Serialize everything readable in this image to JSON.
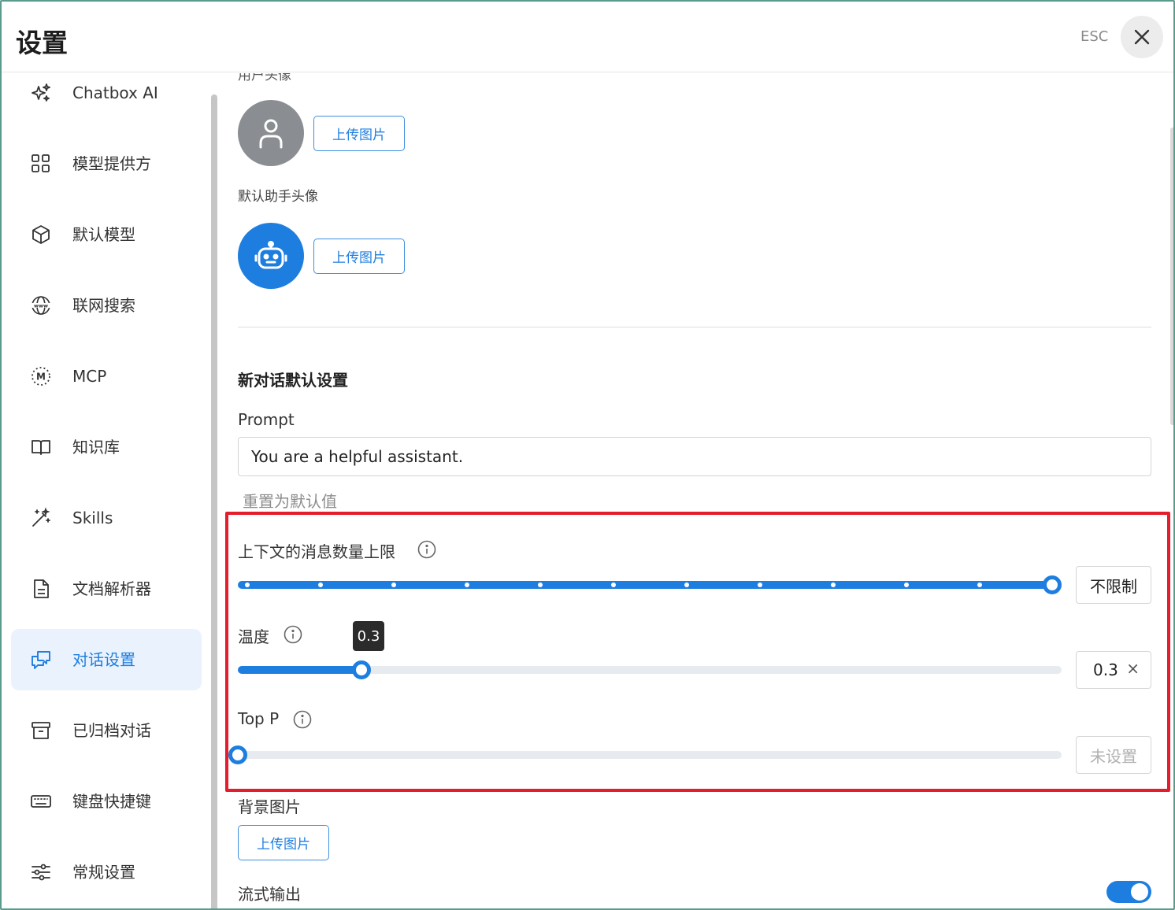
{
  "header": {
    "title": "设置",
    "esc_label": "ESC"
  },
  "sidebar": {
    "items": [
      {
        "label": "Chatbox AI",
        "icon": "sparkle-icon"
      },
      {
        "label": "模型提供方",
        "icon": "grid-icon"
      },
      {
        "label": "默认模型",
        "icon": "cube-icon"
      },
      {
        "label": "联网搜索",
        "icon": "globe-www-icon"
      },
      {
        "label": "MCP",
        "icon": "mcp-icon"
      },
      {
        "label": "知识库",
        "icon": "book-icon"
      },
      {
        "label": "Skills",
        "icon": "magic-wand-icon"
      },
      {
        "label": "文档解析器",
        "icon": "document-icon"
      },
      {
        "label": "对话设置",
        "icon": "chat-bubbles-icon",
        "active": true
      },
      {
        "label": "已归档对话",
        "icon": "archive-icon"
      },
      {
        "label": "键盘快捷键",
        "icon": "keyboard-icon"
      },
      {
        "label": "常规设置",
        "icon": "sliders-icon"
      }
    ]
  },
  "main": {
    "user_avatar": {
      "label": "用户头像",
      "upload_label": "上传图片"
    },
    "assistant_avatar": {
      "label": "默认助手头像",
      "upload_label": "上传图片"
    },
    "section_title": "新对话默认设置",
    "prompt": {
      "label": "Prompt",
      "value": "You are a helpful assistant.",
      "reset_label": "重置为默认值"
    },
    "context_limit": {
      "label": "上下文的消息数量上限",
      "value_label": "不限制",
      "level": 1.0
    },
    "temperature": {
      "label": "温度",
      "value": "0.3",
      "tooltip": "0.3",
      "level": 0.15,
      "clear_symbol": "×"
    },
    "top_p": {
      "label": "Top P",
      "placeholder": "未设置",
      "level": 0.0
    },
    "background": {
      "label": "背景图片",
      "upload_label": "上传图片"
    },
    "stream": {
      "label": "流式输出",
      "enabled": true
    }
  },
  "colors": {
    "accent": "#1e7ee0",
    "highlight": "#e41c2b",
    "active_bg": "#eaf3fd"
  }
}
